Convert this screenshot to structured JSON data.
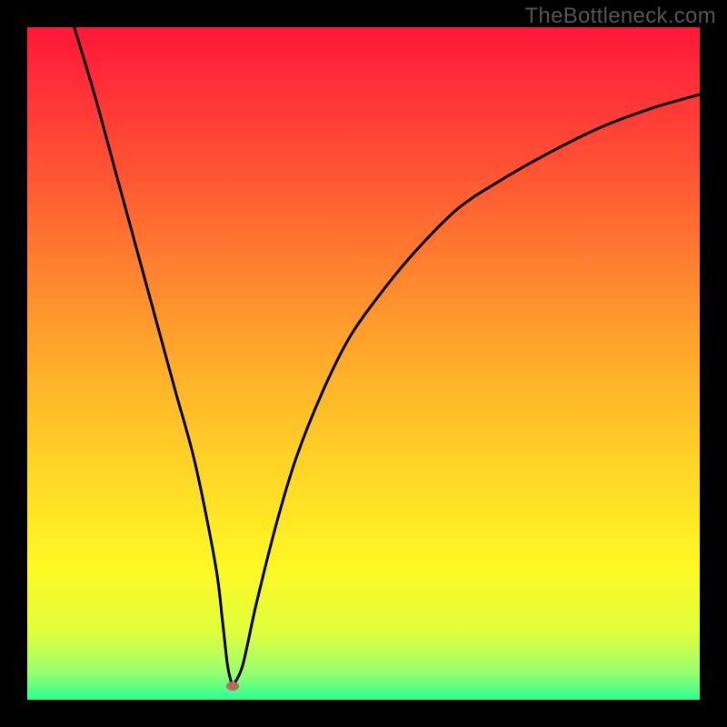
{
  "watermark": "TheBottleneck.com",
  "chart_data": {
    "type": "line",
    "title": "",
    "xlabel": "",
    "ylabel": "",
    "xlim": [
      0,
      100
    ],
    "ylim": [
      0,
      100
    ],
    "background_gradient": {
      "stops": [
        {
          "pos": 0.0,
          "color": "#ff173a"
        },
        {
          "pos": 0.2,
          "color": "#ff4f34"
        },
        {
          "pos": 0.45,
          "color": "#ff9e2c"
        },
        {
          "pos": 0.65,
          "color": "#ffd426"
        },
        {
          "pos": 0.8,
          "color": "#fff723"
        },
        {
          "pos": 0.9,
          "color": "#e0ff3c"
        },
        {
          "pos": 0.96,
          "color": "#97ff70"
        },
        {
          "pos": 1.0,
          "color": "#2bff93"
        }
      ]
    },
    "series": [
      {
        "name": "curve",
        "color": "#000000",
        "x": [
          7,
          10,
          13,
          16,
          19,
          22,
          25,
          28,
          29,
          29.8,
          30.5,
          32,
          34,
          37,
          40,
          44,
          48,
          53,
          58,
          64,
          70,
          77,
          85,
          93,
          100
        ],
        "y": [
          100,
          90,
          79,
          68,
          57,
          46,
          35,
          20,
          12,
          5,
          2,
          5,
          14,
          26,
          36,
          46,
          54,
          61,
          67,
          73,
          77,
          81,
          85,
          88,
          90
        ]
      }
    ],
    "marker": {
      "x": 30.5,
      "y": 2,
      "color": "#bf685f"
    }
  }
}
